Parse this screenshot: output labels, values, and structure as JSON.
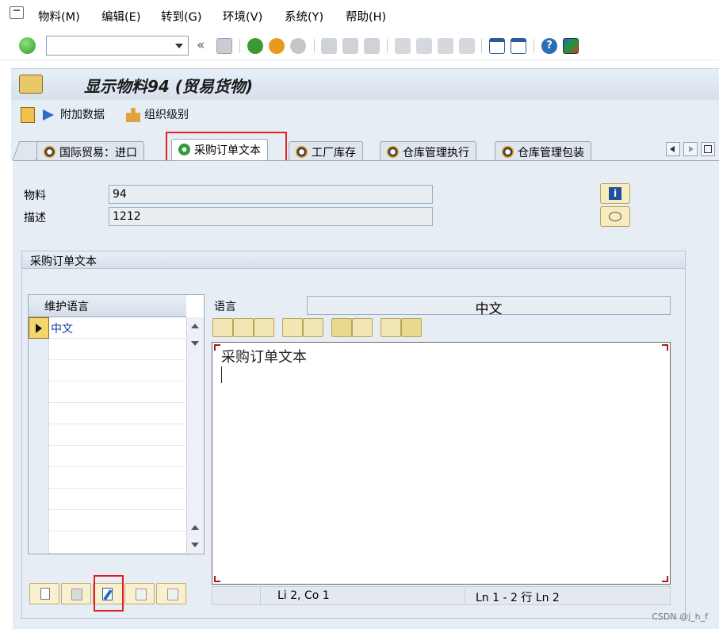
{
  "menu": [
    "物料(M)",
    "编辑(E)",
    "转到(G)",
    "环境(V)",
    "系统(Y)",
    "帮助(H)"
  ],
  "toolbar": {
    "command_value": "",
    "back_glyph": "«"
  },
  "title": "显示物料94 (贸易货物)",
  "app_toolbar": {
    "additional_data": "附加数据",
    "org_levels": "组织级别"
  },
  "tabs": [
    "国际贸易：进口",
    "采购订单文本",
    "工厂库存",
    "仓库管理执行",
    "仓库管理包装"
  ],
  "active_tab": "采购订单文本",
  "fields": {
    "material_label": "物料",
    "material_value": "94",
    "description_label": "描述",
    "description_value": "1212"
  },
  "group": {
    "title": "采购订单文本",
    "table_header": "维护语言",
    "rows": [
      "中文"
    ],
    "language_label": "语言",
    "language_value": "中文",
    "editor_text": "采购订单文本",
    "status_position": "Li 2, Co 1",
    "status_lines": "Ln 1 - 2 行 Ln 2"
  },
  "colors": {
    "highlight": "#e0201e",
    "selected_text": "#0b3ea8"
  },
  "watermark": "CSDN @j_h_f"
}
